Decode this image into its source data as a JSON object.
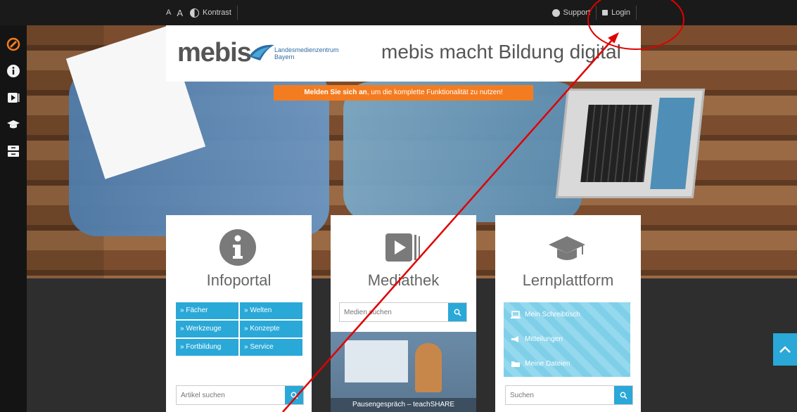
{
  "topbar": {
    "font_smaller": "A",
    "font_larger": "A",
    "contrast_label": "Kontrast",
    "support_label": "Support",
    "login_label": "Login"
  },
  "logo": {
    "brand": "mebis",
    "org_line1": "Landesmedienzentrum",
    "org_line2": "Bayern",
    "claim": "mebis macht Bildung digital"
  },
  "login_notice": {
    "bold": "Melden Sie sich an",
    "rest": ", um die komplette Funktionalität zu nutzen!"
  },
  "cards": {
    "infoportal": {
      "title": "Infoportal",
      "buttons": [
        "» Fächer",
        "» Welten",
        "» Werkzeuge",
        "» Konzepte",
        "» Fortbildung",
        "» Service"
      ],
      "search_placeholder": "Artikel suchen"
    },
    "mediathek": {
      "title": "Mediathek",
      "search_placeholder": "Medien suchen",
      "video_caption": "Pausengespräch – teachSHARE"
    },
    "lernplattform": {
      "title": "Lernplattform",
      "links": [
        "Mein Schreibtisch",
        "Mitteilungen",
        "Meine Dateien"
      ],
      "search_placeholder": "Suchen"
    }
  },
  "colors": {
    "accent_blue": "#2aa8d8",
    "orange": "#f47c20",
    "annotation_red": "#e00000"
  }
}
